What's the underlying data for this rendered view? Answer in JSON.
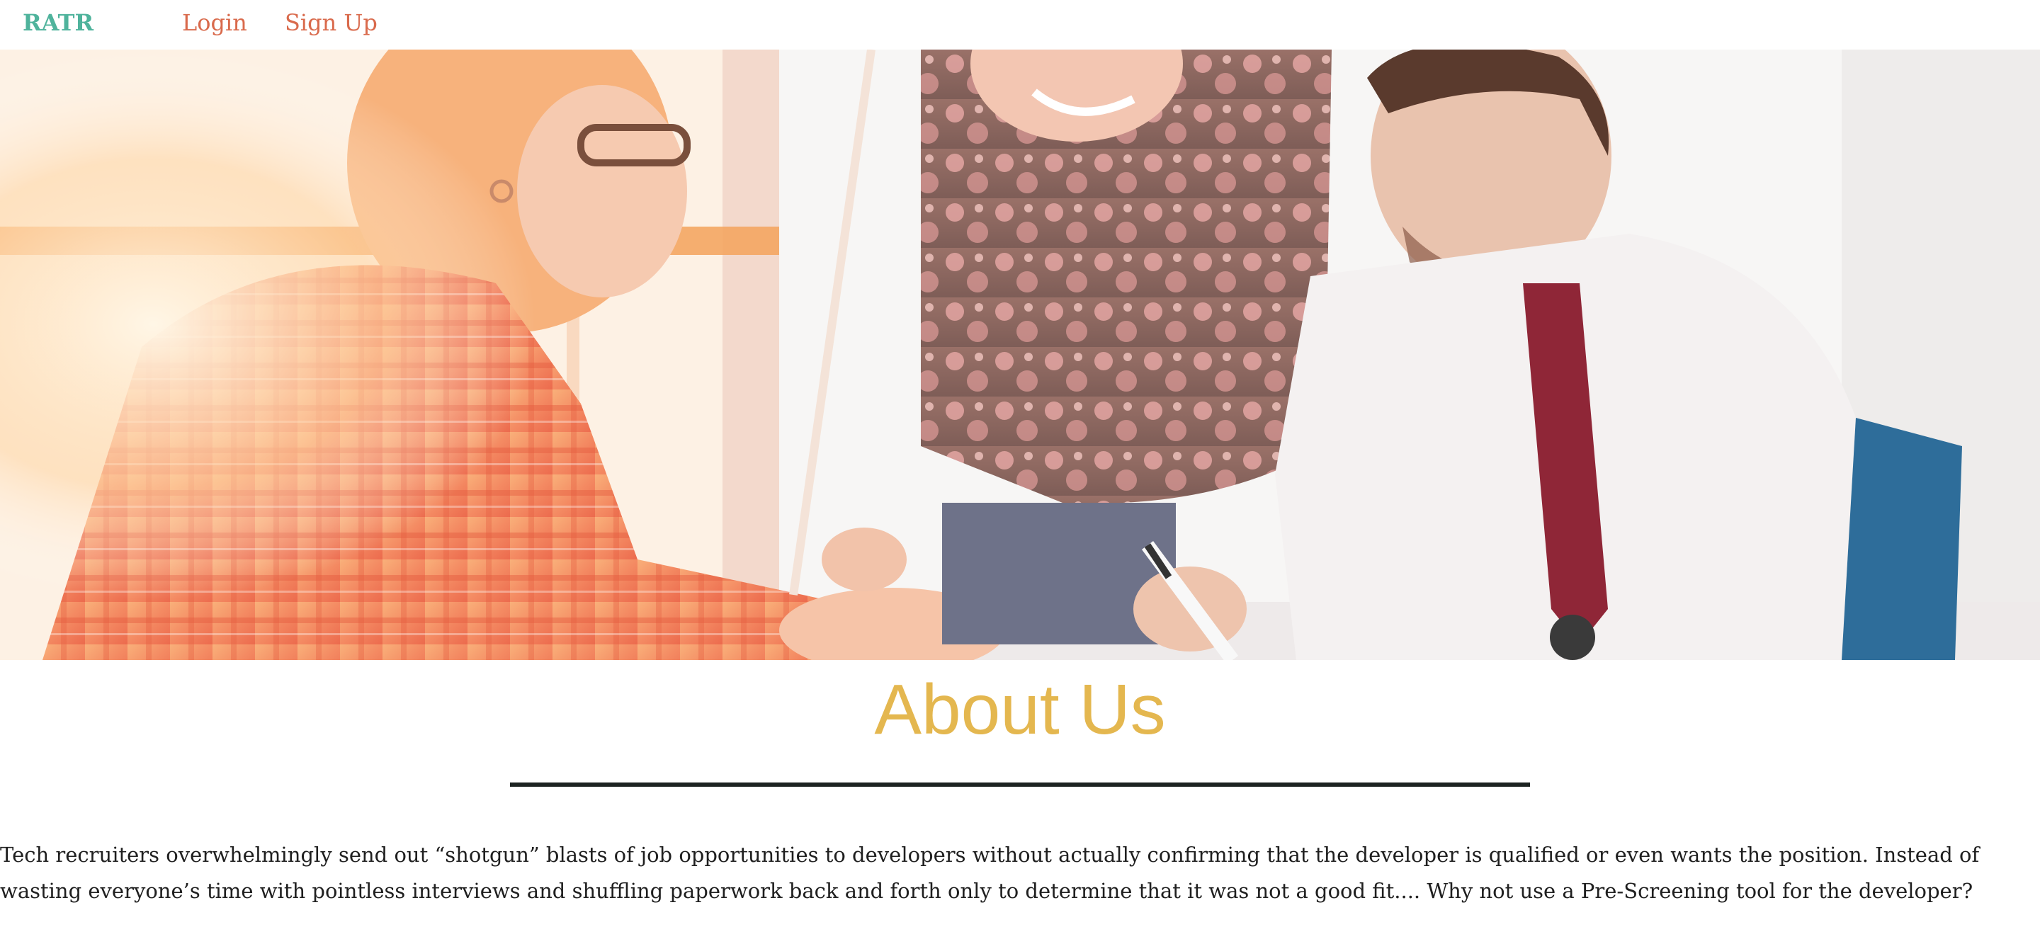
{
  "nav": {
    "brand": "RATR",
    "login_label": "Login",
    "signup_label": "Sign Up"
  },
  "hero": {
    "image_alt": "Three colleagues laughing while reviewing papers at a table"
  },
  "about": {
    "title": "About Us",
    "body": "Tech recruiters overwhelmingly send out “shotgun” blasts of job opportunities to developers without actually confirming that the developer is qualified or even wants the position. Instead of wasting everyone’s time with pointless interviews and shuffling paperwork back and forth only to determine that it was not a good fit.... Why not use a Pre-Screening tool for the developer?"
  },
  "colors": {
    "brand": "#4fb39c",
    "nav_link": "#d96a4c",
    "title": "#e4b74f",
    "divider": "#1c2321",
    "body_text": "#1f1f1f"
  }
}
